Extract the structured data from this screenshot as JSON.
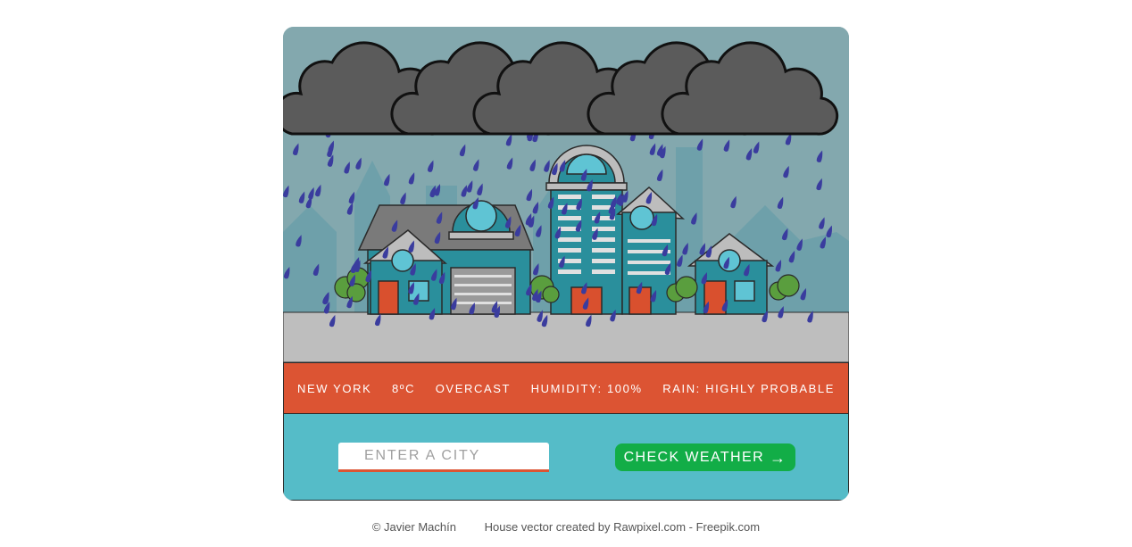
{
  "scene": {
    "cloud_color": "#5b5b5b",
    "sky_color": "#83a8ae",
    "rain_color": "#3a3c9e",
    "house_color": "#2a8f9c",
    "road_color": "#bebebe"
  },
  "weather": {
    "city": "NEW YORK",
    "temperature": "8ºC",
    "condition": "OVERCAST",
    "humidity": "HUMIDITY: 100%",
    "rain": "RAIN: HIGHLY PROBABLE"
  },
  "controls": {
    "city_placeholder": "ENTER A CITY",
    "check_label": "CHECK WEATHER",
    "check_arrow": "→"
  },
  "footer": {
    "author": "© Javier Machín",
    "credit": "House vector created by Rawpixel.com - Freepik.com"
  },
  "colors": {
    "accent": "#dc5433",
    "panel": "#55bcc8",
    "button": "#12ad47"
  }
}
